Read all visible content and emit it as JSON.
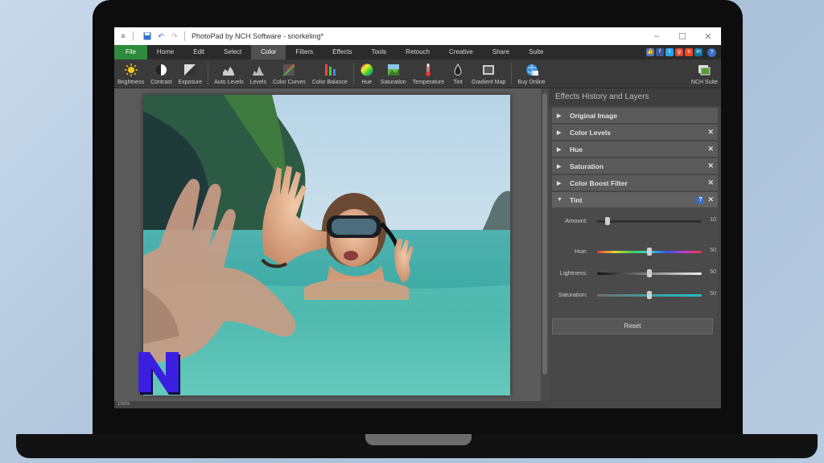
{
  "app": {
    "title": "PhotoPad by NCH Software - snorkeling*",
    "window_controls": [
      "–",
      "☐",
      "✕"
    ]
  },
  "menu": {
    "items": [
      "File",
      "Home",
      "Edit",
      "Select",
      "Color",
      "Filters",
      "Effects",
      "Tools",
      "Retouch",
      "Creative",
      "Share",
      "Suite"
    ],
    "active": "Color",
    "help_label": "?"
  },
  "toolbar": {
    "tools": [
      {
        "label": "Brightness",
        "icon": "brightness-icon"
      },
      {
        "label": "Contrast",
        "icon": "contrast-icon"
      },
      {
        "label": "Exposure",
        "icon": "exposure-icon"
      },
      {
        "label": "Auto Levels",
        "icon": "auto-levels-icon"
      },
      {
        "label": "Levels",
        "icon": "levels-icon"
      },
      {
        "label": "Color Curves",
        "icon": "color-curves-icon"
      },
      {
        "label": "Color Balance",
        "icon": "color-balance-icon"
      },
      {
        "label": "Hue",
        "icon": "hue-icon"
      },
      {
        "label": "Saturation",
        "icon": "saturation-icon"
      },
      {
        "label": "Temperature",
        "icon": "temperature-icon"
      },
      {
        "label": "Tint",
        "icon": "tint-icon"
      },
      {
        "label": "Gradient Map",
        "icon": "gradient-map-icon"
      },
      {
        "label": "Buy Online",
        "icon": "buy-online-icon"
      },
      {
        "label": "NCH Suite",
        "icon": "nch-suite-icon"
      }
    ]
  },
  "status": {
    "zoom": "100%"
  },
  "panel": {
    "title": "Effects History and Layers",
    "layers": [
      {
        "label": "Original Image"
      },
      {
        "label": "Color Levels"
      },
      {
        "label": "Hue"
      },
      {
        "label": "Saturation"
      },
      {
        "label": "Color Boost Filter"
      },
      {
        "label": "Tint"
      }
    ],
    "tint": {
      "amount": {
        "label": "Amount:",
        "value": "10"
      },
      "hue": {
        "label": "Hue:",
        "value": "50"
      },
      "lightness": {
        "label": "Lightness:",
        "value": "50"
      },
      "saturation": {
        "label": "Saturation:",
        "value": "50"
      },
      "slider_fractions": {
        "amount": 0.1,
        "hue": 0.5,
        "lightness": 0.5,
        "saturation": 0.5
      },
      "reset_label": "Reset"
    }
  },
  "colors": {
    "file_tab": "#2e8b3b",
    "accent_blue": "#3a6fc9",
    "logo_fill": "#3b1fe0"
  }
}
